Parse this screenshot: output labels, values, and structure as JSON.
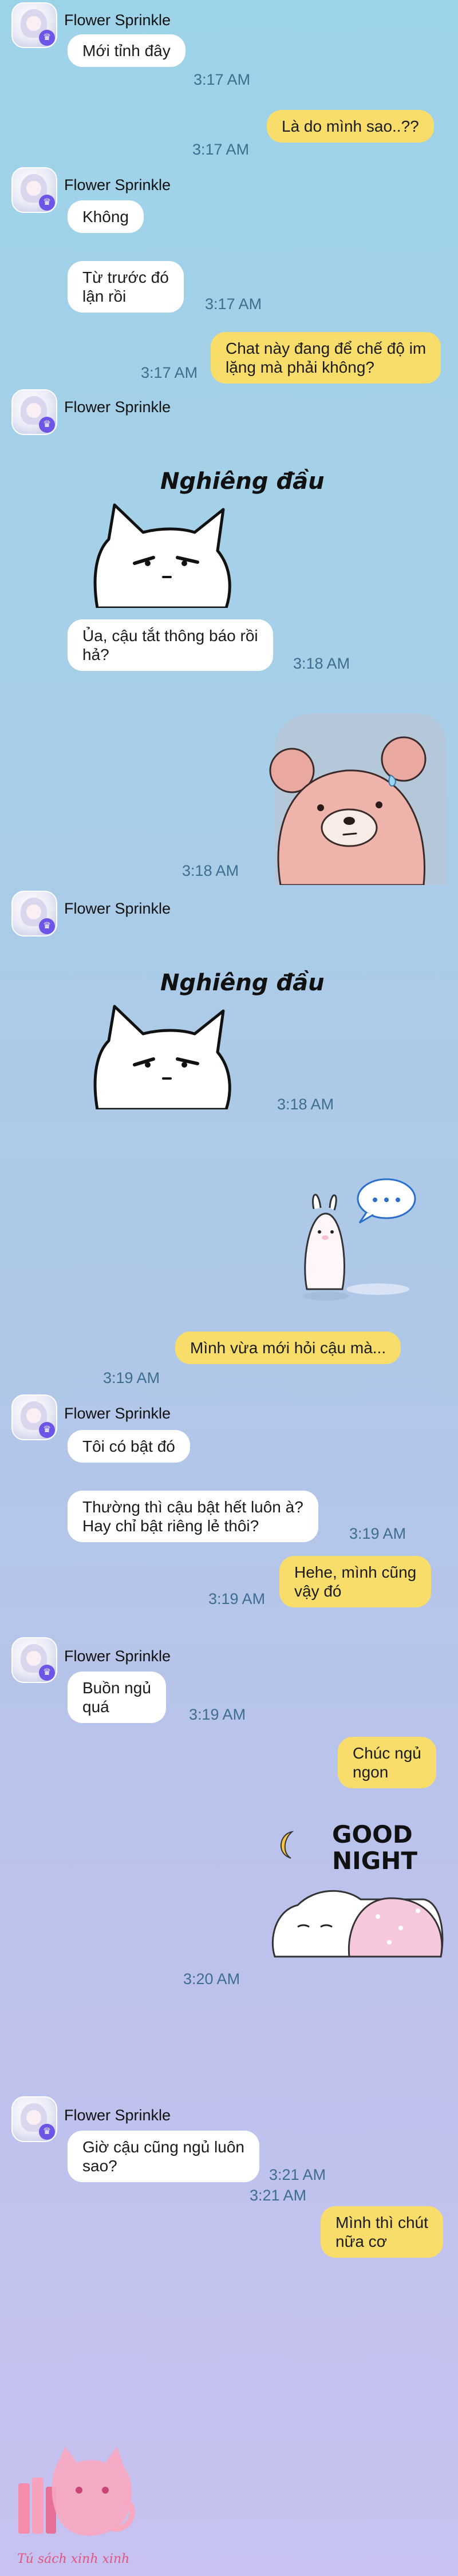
{
  "contact": {
    "name": "Flower Sprinkle",
    "avatar_icon": "profile-avatar-icon",
    "badge_icon": "crown-badge-icon"
  },
  "messages": [
    {
      "from": "them",
      "text": "Mới tỉnh đây",
      "time": "3:17 AM"
    },
    {
      "from": "me",
      "text": "Là do mình sao..??",
      "time": "3:17 AM"
    },
    {
      "from": "them",
      "text": "Không"
    },
    {
      "from": "them",
      "text": "Từ trước đó\nlận rồi",
      "time": "3:17 AM"
    },
    {
      "from": "me",
      "text": "Chat này đang để chế độ im\nlặng mà phải không?",
      "time": "3:17 AM"
    },
    {
      "from": "them",
      "sticker": "white-cat-sticker",
      "sticker_text": "Nghiêng đầu"
    },
    {
      "from": "them",
      "text": "Ủa, cậu tắt thông báo rồi\nhả?",
      "time": "3:18 AM"
    },
    {
      "from": "me",
      "sticker": "sweating-bear-sticker",
      "time": "3:18 AM"
    },
    {
      "from": "them",
      "sticker": "white-cat-sticker",
      "sticker_text": "Nghiêng đầu",
      "time": "3:18 AM"
    },
    {
      "from": "them",
      "sticker": "bunny-thinking-sticker"
    },
    {
      "from": "me",
      "text": "Mình vừa mới hỏi cậu mà...",
      "time": "3:19 AM"
    },
    {
      "from": "them",
      "text": "Tôi có bật đó"
    },
    {
      "from": "them",
      "text": "Thường thì cậu bật hết luôn à?\nHay chỉ bật riêng lẻ thôi?",
      "time": "3:19 AM"
    },
    {
      "from": "me",
      "text": "Hehe, mình cũng\nvậy đó",
      "time": "3:19 AM"
    },
    {
      "from": "them",
      "text": "Buồn ngủ\nquá",
      "time": "3:19 AM"
    },
    {
      "from": "me",
      "text": "Chúc ngủ\nngon"
    },
    {
      "from": "me",
      "sticker": "good-night-bunny-sticker",
      "sticker_text": "GOOD\nNIGHT",
      "time": "3:20 AM"
    },
    {
      "from": "them",
      "text": "Giờ cậu cũng ngủ luôn\nsao?",
      "time": "3:21 AM"
    },
    {
      "from": "me",
      "text": "Mình thì chút\nnữa cơ",
      "time": "3:21 AM"
    }
  ],
  "watermark": {
    "text": "Tú sách xinh xinh",
    "icon": "pink-cat-logo-icon"
  },
  "colors": {
    "my_bubble": "#f8dd6a",
    "their_bubble": "#ffffff",
    "timestamp": "#3d6e8f",
    "background_top": "#9dd3e9",
    "background_bottom": "#c7c2f1"
  }
}
